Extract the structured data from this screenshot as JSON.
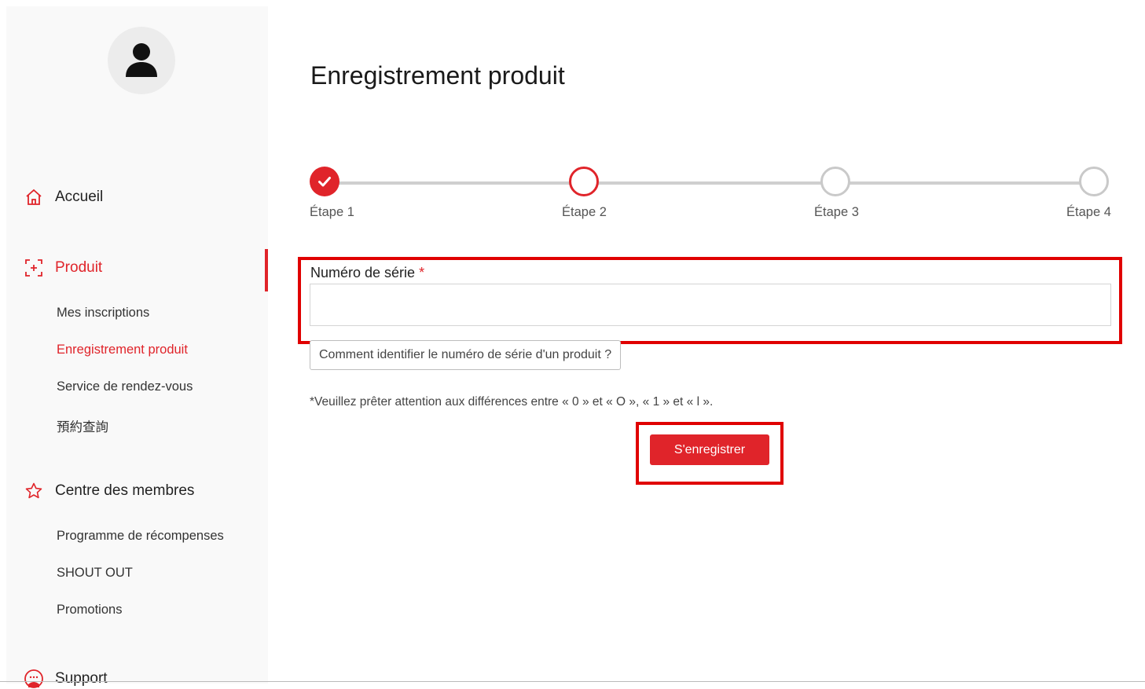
{
  "sidebar": {
    "home_label": "Accueil",
    "product_label": "Produit",
    "product_items": [
      {
        "label": "Mes inscriptions"
      },
      {
        "label": "Enregistrement produit"
      },
      {
        "label": "Service de rendez-vous"
      },
      {
        "label": "預約查詢"
      }
    ],
    "members_label": "Centre des membres",
    "members_items": [
      {
        "label": "Programme de récompenses"
      },
      {
        "label": "SHOUT OUT"
      },
      {
        "label": "Promotions"
      }
    ],
    "support_label": "Support",
    "active_item": "Enregistrement produit"
  },
  "main": {
    "title": "Enregistrement produit",
    "steps": [
      {
        "label": "Étape 1",
        "state": "done"
      },
      {
        "label": "Étape 2",
        "state": "current"
      },
      {
        "label": "Étape 3",
        "state": "todo"
      },
      {
        "label": "Étape 4",
        "state": "todo"
      }
    ],
    "serial_label": "Numéro de série",
    "required_mark": "*",
    "serial_value": "",
    "help_button_label": "Comment identifier le numéro de série d'un produit ?",
    "note": "*Veuillez prêter attention aux différences entre « 0 » et « O », « 1 » et « l ».",
    "submit_label": "S'enregistrer"
  },
  "colors": {
    "accent": "#e0242a",
    "highlight": "#e00000",
    "inactive_step": "#c9c9c9"
  }
}
